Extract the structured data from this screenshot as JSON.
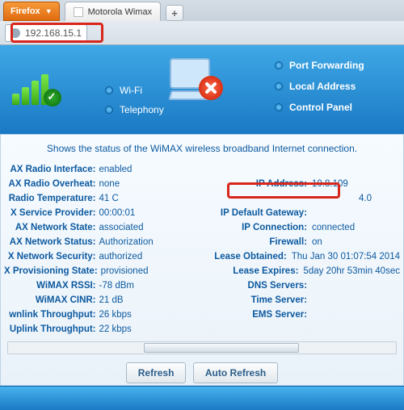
{
  "browser": {
    "name": "Firefox",
    "tab_title": "Motorola Wimax",
    "url": "192.168.15.1",
    "newtab": "+"
  },
  "nav_mid": {
    "wifi": "Wi-Fi",
    "telephony": "Telephony"
  },
  "nav_right": {
    "port": "Port Forwarding",
    "local": "Local Address",
    "cpanel": "Control Panel"
  },
  "intro": "Shows the status of the WiMAX wireless broadband Internet connection.",
  "left": {
    "radio_iface_k": "AX Radio Interface:",
    "radio_iface_v": "enabled",
    "radio_oh_k": "AX Radio Overheat:",
    "radio_oh_v": "none",
    "radio_temp_k": "Radio Temperature:",
    "radio_temp_v": "41 C",
    "svc_prov_k": "X Service Provider:",
    "svc_prov_v": "00:00:01",
    "net_state_k": "AX Network State:",
    "net_state_v": "associated",
    "net_status_k": "AX Network Status:",
    "net_status_v": "Authorization",
    "net_sec_k": "X Network Security:",
    "net_sec_v": "authorized",
    "prov_state_k": "X Provisioning State:",
    "prov_state_v": "provisioned",
    "rssi_k": "WiMAX RSSI:",
    "rssi_v": "-78 dBm",
    "cinr_k": "WiMAX CINR:",
    "cinr_v": "21 dB",
    "dl_k": "wnlink Throughput:",
    "dl_v": "26 kbps",
    "ul_k": "Uplink Throughput:",
    "ul_v": "22 kbps"
  },
  "right": {
    "ip_k": "IP Address:",
    "ip_v": "10.8.109",
    "subnet_frag": "4.0",
    "gw_k": "IP Default Gateway:",
    "conn_k": "IP Connection:",
    "conn_v": "connected",
    "fw_k": "Firewall:",
    "fw_v": "on",
    "lobt_k": "Lease Obtained:",
    "lobt_v": "Thu Jan 30 01:07:54 2014",
    "lexp_k": "Lease Expires:",
    "lexp_v": "5day 20hr 53min 40sec",
    "dns_k": "DNS Servers:",
    "time_k": "Time Server:",
    "ems_k": "EMS Server:"
  },
  "buttons": {
    "refresh": "Refresh",
    "auto": "Auto Refresh"
  }
}
